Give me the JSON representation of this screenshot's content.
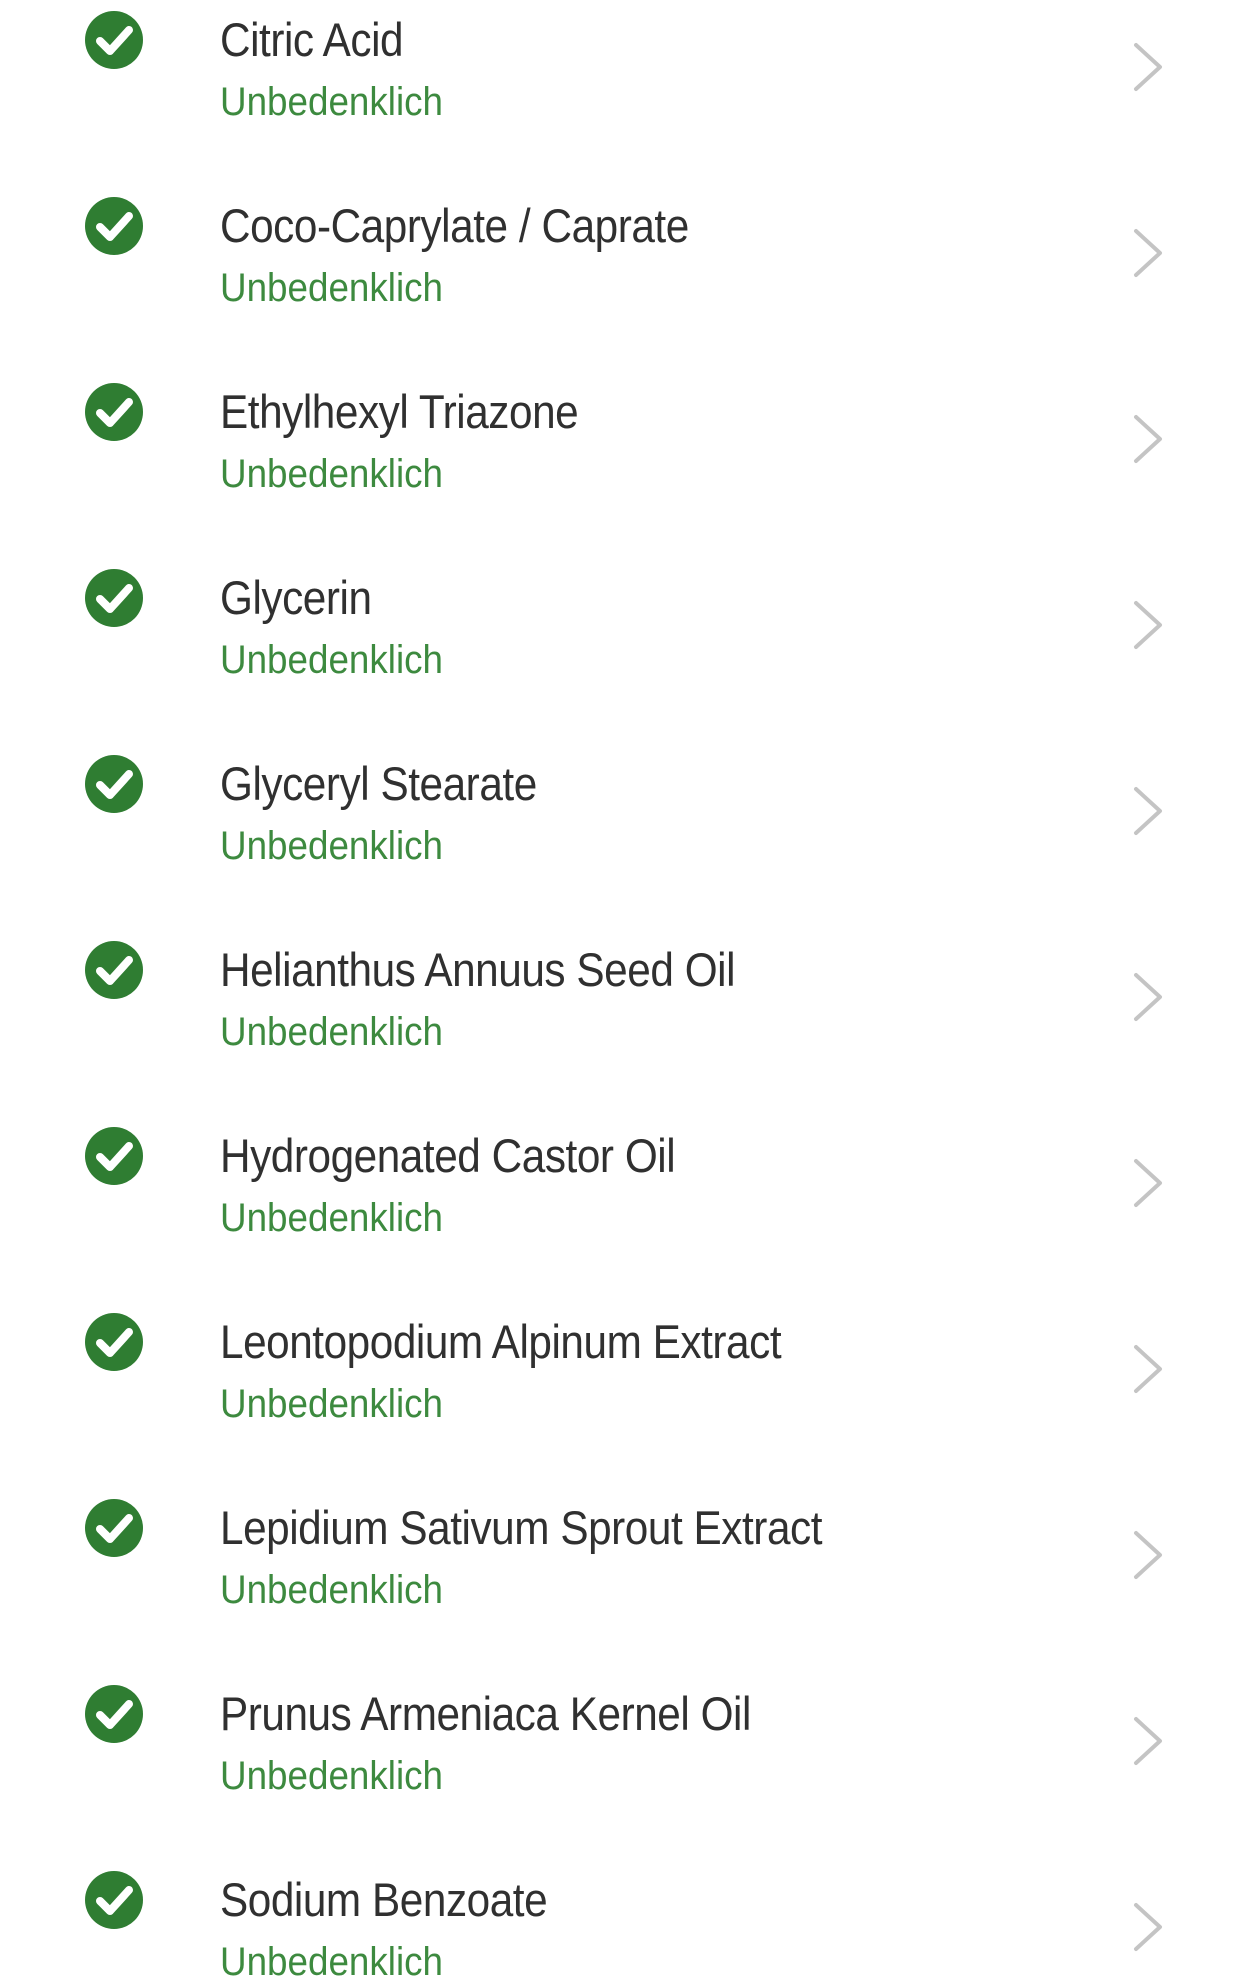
{
  "colors": {
    "accent_green": "#3d8a3f",
    "icon_green": "#2f7d32",
    "name_text": "#303030",
    "chevron": "#c4c4c4"
  },
  "icons": {
    "status": "check-circle-icon",
    "row_action": "chevron-right-icon"
  },
  "ingredients": [
    {
      "name": "Citric Acid",
      "rating": "Unbedenklich"
    },
    {
      "name": "Coco-Caprylate / Caprate",
      "rating": "Unbedenklich"
    },
    {
      "name": "Ethylhexyl Triazone",
      "rating": "Unbedenklich"
    },
    {
      "name": "Glycerin",
      "rating": "Unbedenklich"
    },
    {
      "name": "Glyceryl Stearate",
      "rating": "Unbedenklich"
    },
    {
      "name": "Helianthus Annuus Seed Oil",
      "rating": "Unbedenklich"
    },
    {
      "name": "Hydrogenated Castor Oil",
      "rating": "Unbedenklich"
    },
    {
      "name": "Leontopodium Alpinum Extract",
      "rating": "Unbedenklich"
    },
    {
      "name": "Lepidium Sativum Sprout Extract",
      "rating": "Unbedenklich"
    },
    {
      "name": "Prunus Armeniaca Kernel Oil",
      "rating": "Unbedenklich"
    },
    {
      "name": "Sodium Benzoate",
      "rating": "Unbedenklich"
    }
  ]
}
